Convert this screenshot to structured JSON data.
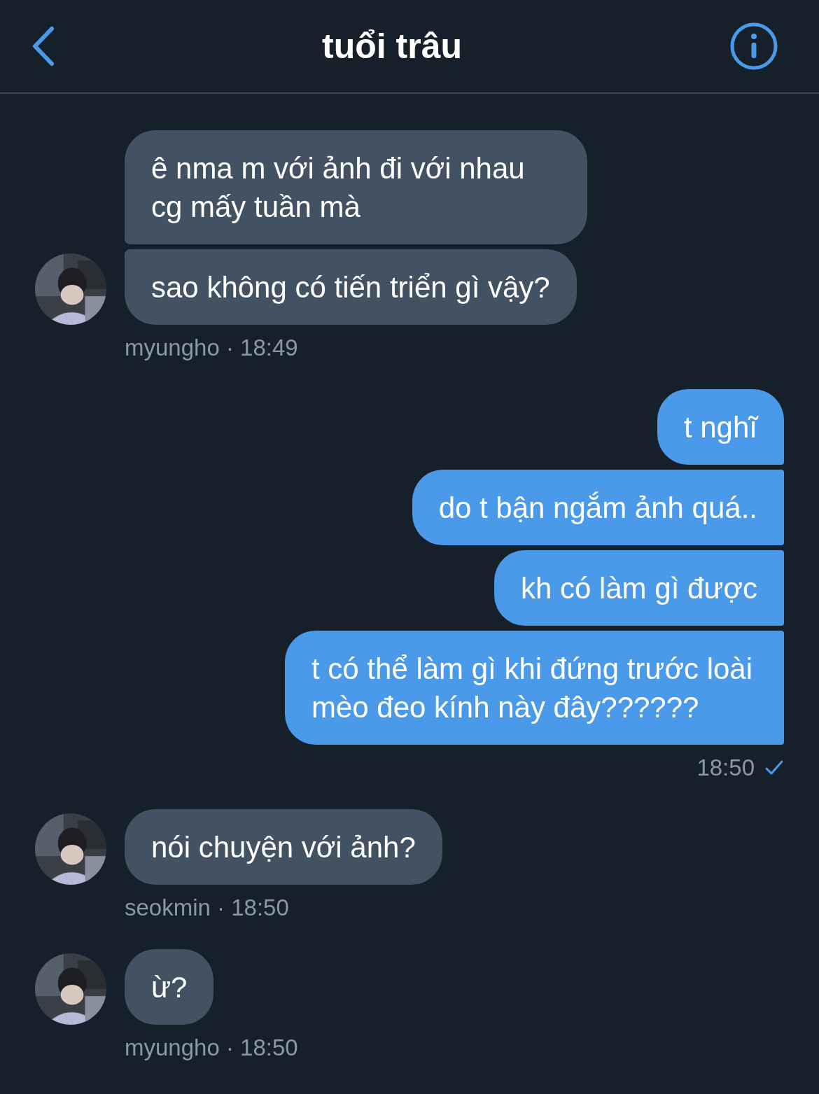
{
  "header": {
    "title": "tuổi trâu"
  },
  "groups": [
    {
      "kind": "incoming",
      "avatar": {
        "kind": "picture"
      },
      "bubbles": [
        "ê nma m với ảnh đi với nhau cg mấy tuần mà",
        "sao không có tiến triển gì vậy?"
      ],
      "meta": "myungho · 18:49"
    },
    {
      "kind": "outgoing",
      "bubbles": [
        "t nghĩ",
        "do t bận ngắm ảnh quá..",
        "kh có làm gì được",
        "t có thể làm gì khi đứng trước loài mèo đeo kính này đây??????"
      ],
      "meta": "18:50",
      "read": true
    },
    {
      "kind": "incoming",
      "avatar": {
        "kind": "picture"
      },
      "bubbles": [
        "nói chuyện với ảnh?"
      ],
      "meta": "seokmin · 18:50"
    },
    {
      "kind": "incoming",
      "avatar": {
        "kind": "picture"
      },
      "bubbles": [
        "ừ?"
      ],
      "meta": "myungho · 18:50"
    }
  ]
}
